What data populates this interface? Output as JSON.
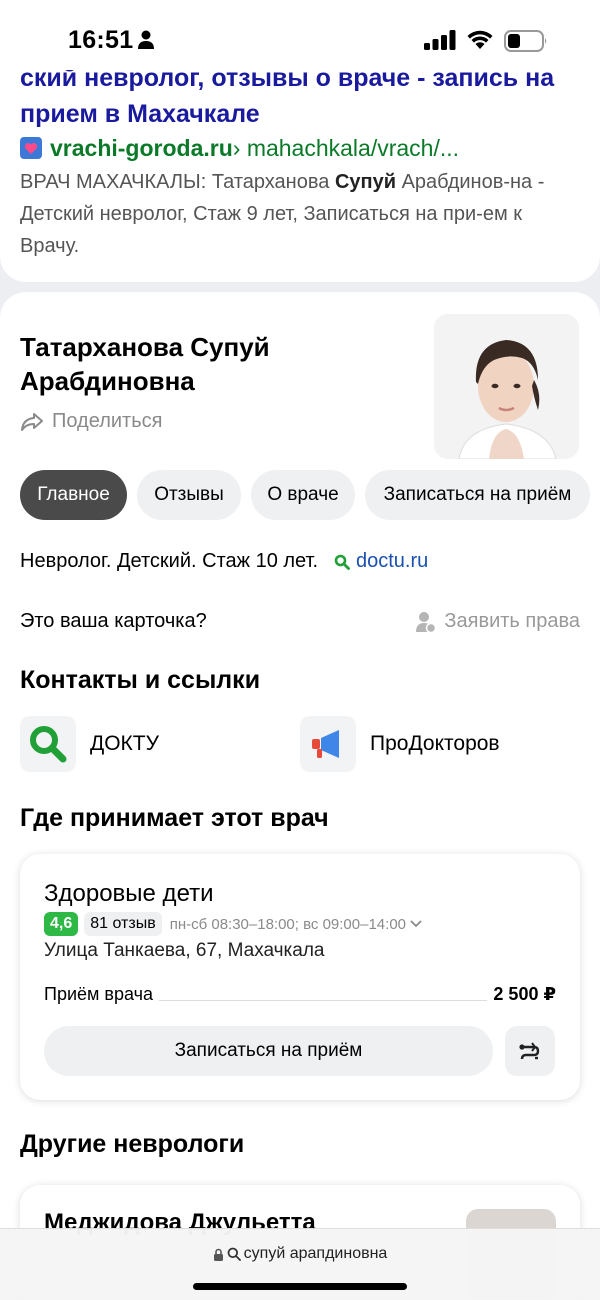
{
  "status_bar": {
    "time": "16:51"
  },
  "search_result": {
    "title": "ский невролог, отзывы о враче - запись на прием в Махачкале",
    "url_domain": "vrachi-goroda.ru",
    "url_path": " › mahachkala/vrach/...",
    "snippet_part1": "ВРАЧ МАХАЧКАЛЫ: Татарханова ",
    "snippet_bold": "Супуй",
    "snippet_part2": " Арабдинов-на - Детский невролог, Стаж 9 лет, Записаться на при-ем к Врачу."
  },
  "doctor": {
    "name": "Татарханова Супуй Арабдиновна",
    "share_label": "Поделиться",
    "tabs": [
      {
        "label": "Главное",
        "active": true
      },
      {
        "label": "Отзывы",
        "active": false
      },
      {
        "label": "О враче",
        "active": false
      },
      {
        "label": "Записаться на приём",
        "active": false
      }
    ],
    "specialty": "Невролог. Детский. Стаж 10 лет.",
    "specialty_source": "doctu.ru",
    "claim_question": "Это ваша карточка?",
    "claim_link": "Заявить права"
  },
  "contacts": {
    "title": "Контакты и ссылки",
    "items": [
      {
        "label": "ДОКТУ",
        "icon": "doctu-search-icon"
      },
      {
        "label": "ПроДокторов",
        "icon": "megaphone-icon"
      }
    ]
  },
  "clinics": {
    "title": "Где принимает этот врач",
    "clinic": {
      "name": "Здоровые дети",
      "rating": "4,6",
      "reviews": "81 отзыв",
      "hours": "пн-сб 08:30–18:00; вс 09:00–14:00",
      "address": "Улица Танкаева, 67, Махачкала",
      "service": "Приём врача",
      "price": "2 500 ₽",
      "book_label": "Записаться на приём"
    }
  },
  "others": {
    "title": "Другие неврологи",
    "first_name": "Меджидова Джульетта"
  },
  "address_bar": {
    "query": "супуй арапдиновна"
  },
  "colors": {
    "link_title": "#1a1a9e",
    "url_green": "#0a7a28",
    "rating_green": "#2eb845",
    "active_tab": "#4a4a4a",
    "link_blue": "#1a50b0"
  }
}
